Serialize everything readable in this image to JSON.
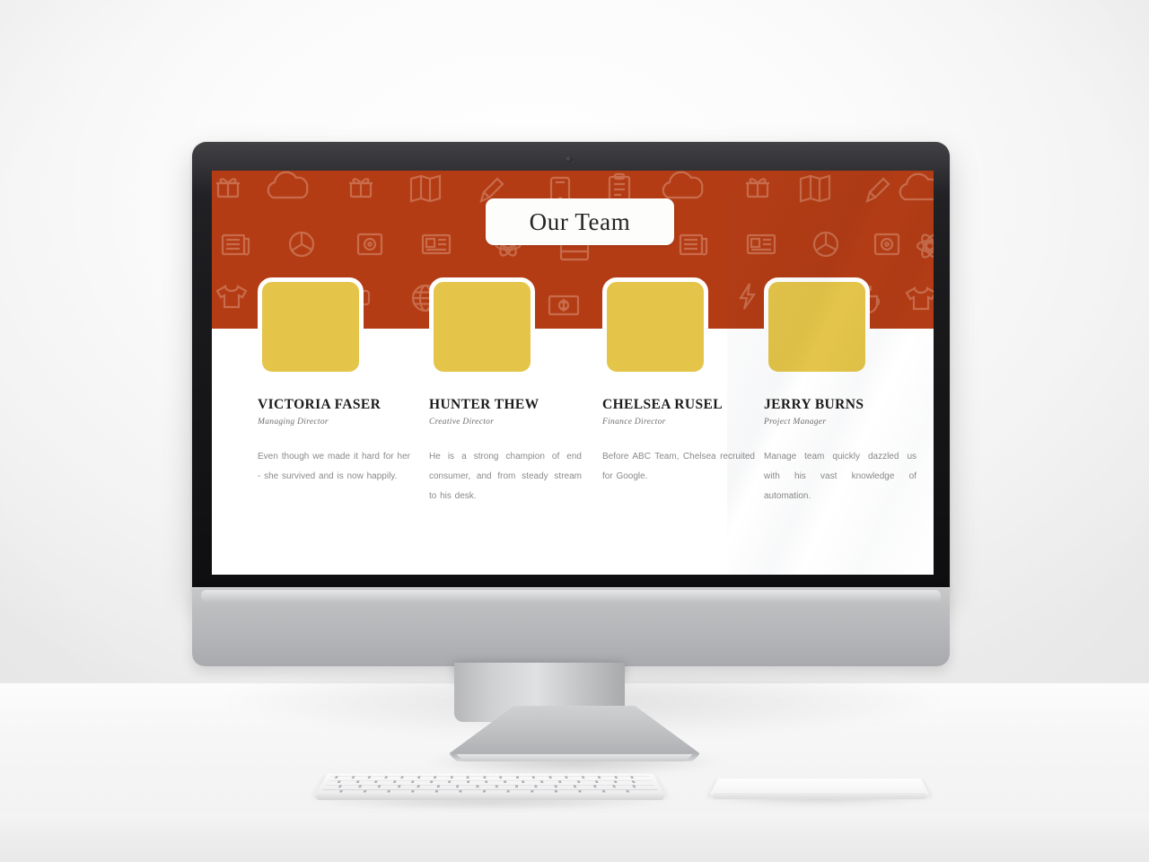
{
  "scene": {
    "device": "imac-desktop-monitor",
    "peripherals": [
      "keyboard",
      "trackpad"
    ]
  },
  "slide": {
    "title": "Our Team",
    "colors": {
      "band_red": "#b33c15",
      "photo_yellow": "#e5c549",
      "slide_white": "#ffffff",
      "title_text": "#262424",
      "name_text": "#1d1c1c",
      "role_text": "#6d6c6c",
      "bio_text": "#8b8a8a"
    },
    "pattern_icons": [
      "gift-icon",
      "cloud-icon",
      "map-icon",
      "pencil-icon",
      "tablet-icon",
      "newspaper-icon",
      "pie-chart-icon",
      "safe-icon",
      "article-icon",
      "tshirt-icon",
      "lightning-icon",
      "speech-bubble-icon",
      "globe-icon",
      "coffee-cup-icon",
      "photo-icon",
      "money-icon",
      "clipboard-icon",
      "briefcase-icon",
      "alarm-clock-icon",
      "phone-icon",
      "compass-icon",
      "books-icon",
      "atom-icon",
      "cart-icon",
      "burger-icon",
      "folder-icon"
    ],
    "members": [
      {
        "name": "VICTORIA FASER",
        "role": "Managing Director",
        "bio": "Even though we made it hard for her - she survived and is now happily."
      },
      {
        "name": "HUNTER  THEW",
        "role": "Creative Director",
        "bio": "He is a strong champion of end consumer, and from steady stream to his desk."
      },
      {
        "name": "CHELSEA  RUSEL",
        "role": "Finance Director",
        "bio": "Before ABC Team, Chelsea recruited for Google."
      },
      {
        "name": "JERRY BURNS",
        "role": "Project Manager",
        "bio": "Manage team quickly dazzled us with his vast knowledge of automation."
      }
    ]
  }
}
